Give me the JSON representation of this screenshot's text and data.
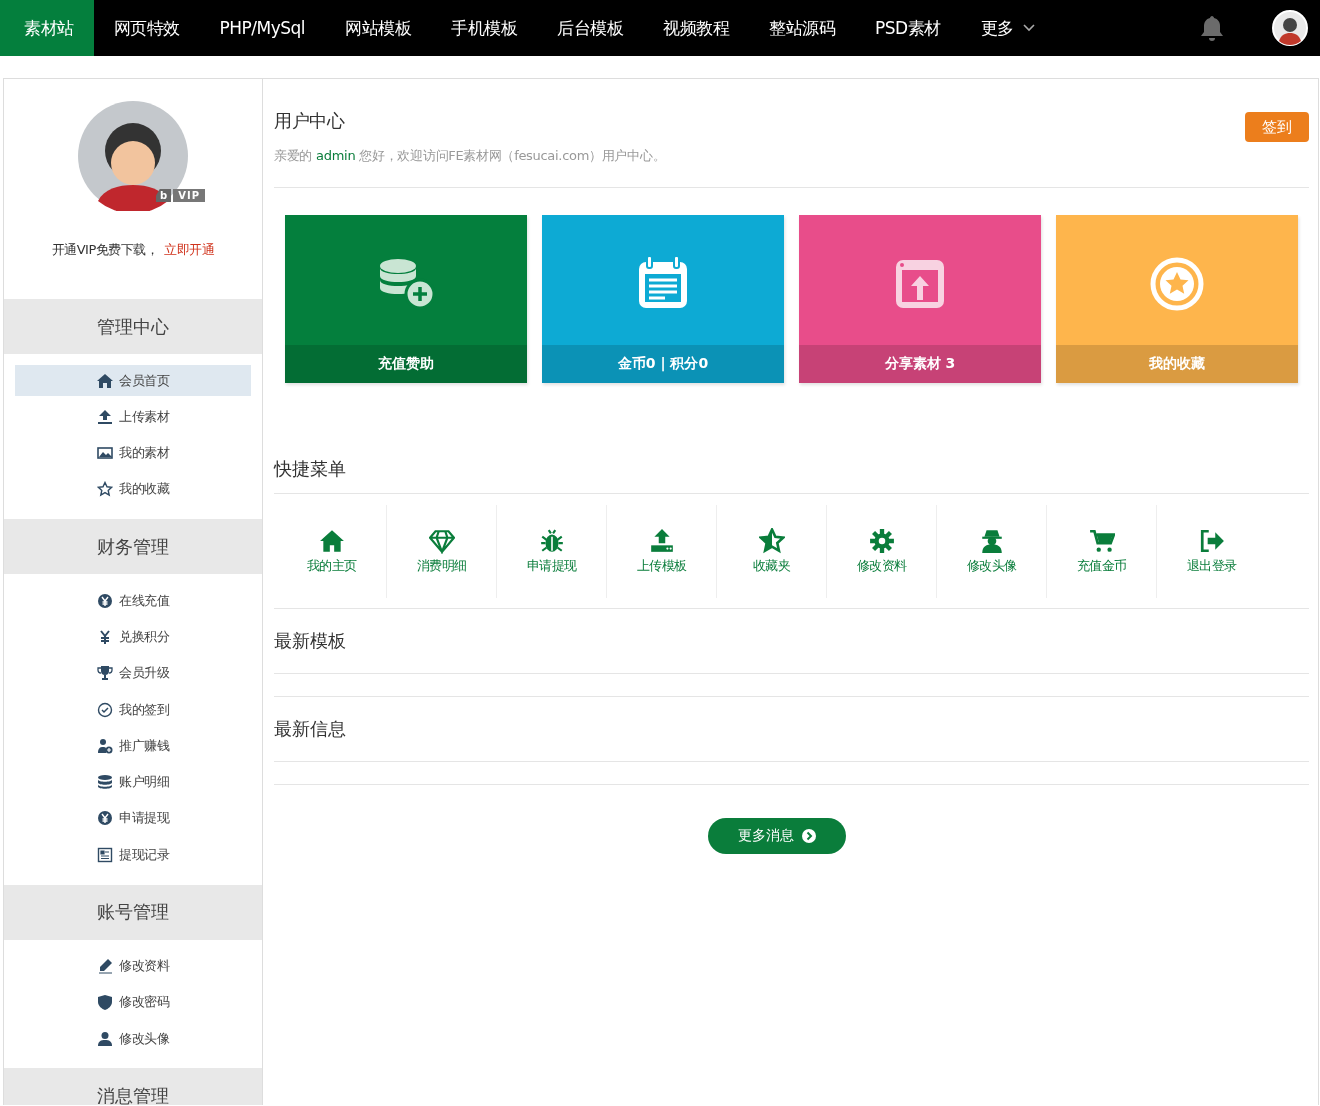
{
  "nav": {
    "items": [
      {
        "label": "素材站",
        "selected": true,
        "kind": "link"
      },
      {
        "label": "网页特效",
        "selected": false,
        "kind": "link"
      },
      {
        "label": "PHP/MySql",
        "selected": false,
        "kind": "link"
      },
      {
        "label": "网站模板",
        "selected": false,
        "kind": "link"
      },
      {
        "label": "手机模板",
        "selected": false,
        "kind": "link"
      },
      {
        "label": "后台模板",
        "selected": false,
        "kind": "link"
      },
      {
        "label": "视频教程",
        "selected": false,
        "kind": "link"
      },
      {
        "label": "整站源码",
        "selected": false,
        "kind": "link"
      },
      {
        "label": "PSD素材",
        "selected": false,
        "kind": "link"
      },
      {
        "label": "更多",
        "selected": false,
        "kind": "menu"
      }
    ]
  },
  "sidebar": {
    "vip_badge": {
      "mark": "b",
      "label": "VIP"
    },
    "promo": {
      "text": "开通VIP免费下载，",
      "link": "立即开通"
    },
    "sections": [
      {
        "title": "管理中心",
        "items": [
          {
            "label": "会员首页",
            "selected": true
          },
          {
            "label": "上传素材",
            "selected": false
          },
          {
            "label": "我的素材",
            "selected": false
          },
          {
            "label": "我的收藏",
            "selected": false
          }
        ]
      },
      {
        "title": "财务管理",
        "items": [
          {
            "label": "在线充值",
            "selected": false
          },
          {
            "label": "兑换积分",
            "selected": false
          },
          {
            "label": "会员升级",
            "selected": false
          },
          {
            "label": "我的签到",
            "selected": false
          },
          {
            "label": "推广赚钱",
            "selected": false
          },
          {
            "label": "账户明细",
            "selected": false
          },
          {
            "label": "申请提现",
            "selected": false
          },
          {
            "label": "提现记录",
            "selected": false
          }
        ]
      },
      {
        "title": "账号管理",
        "items": [
          {
            "label": "修改资料",
            "selected": false
          },
          {
            "label": "修改密码",
            "selected": false
          },
          {
            "label": "修改头像",
            "selected": false
          }
        ]
      },
      {
        "title": "消息管理"
      }
    ]
  },
  "main": {
    "title": "用户中心",
    "greeting_prefix": "亲爱的",
    "user": "admin",
    "greeting_suffix": "您好，欢迎访问FE素材网（fesucai.com）用户中心。",
    "sign_in_button": "签到",
    "tiles": [
      {
        "label": "充值赞助",
        "color": "#047f3d"
      },
      {
        "label": "金币0 | 积分0",
        "color": "#0daad4"
      },
      {
        "label": "分享素材 3",
        "color": "#e84d8a"
      },
      {
        "label": "我的收藏",
        "color": "#feb54c"
      }
    ],
    "quick_menu": {
      "title": "快捷菜单",
      "items": [
        "我的主页",
        "消费明细",
        "申请提现",
        "上传模板",
        "收藏夹",
        "修改资料",
        "修改头像",
        "充值金币",
        "退出登录"
      ]
    },
    "sections": [
      {
        "title": "最新模板"
      },
      {
        "title": "最新信息"
      }
    ],
    "more_button": "更多消息"
  }
}
